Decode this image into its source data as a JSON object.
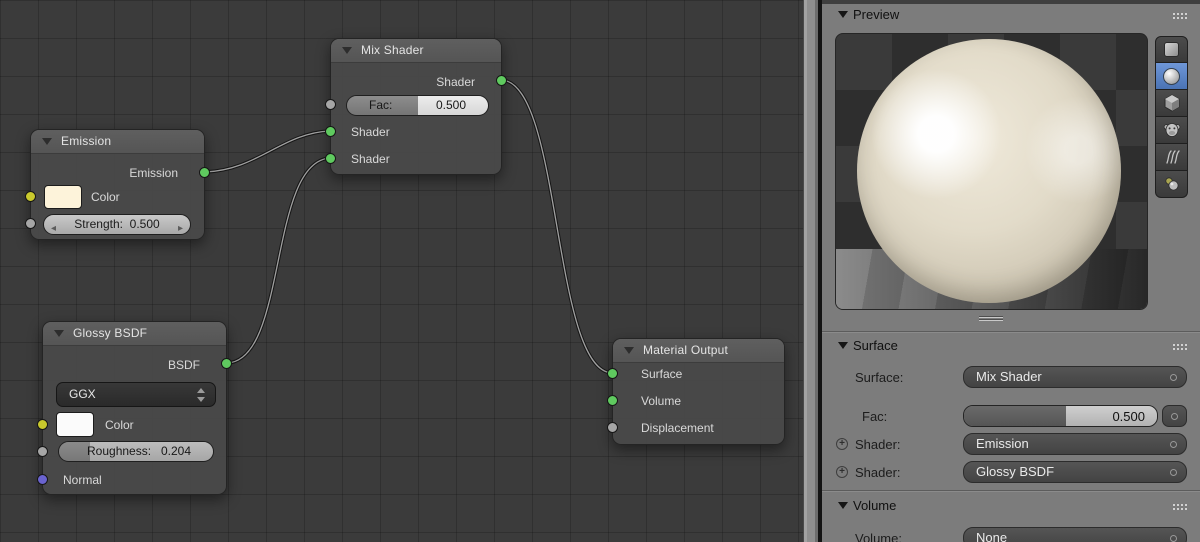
{
  "editor": {
    "nodes": {
      "mix_shader": {
        "title": "Mix Shader",
        "output_label": "Shader",
        "fac_label": "Fac:",
        "fac_value": "0.500",
        "input1_label": "Shader",
        "input2_label": "Shader"
      },
      "emission": {
        "title": "Emission",
        "output_label": "Emission",
        "color_label": "Color",
        "strength_label": "Strength:",
        "strength_value": "0.500"
      },
      "glossy": {
        "title": "Glossy BSDF",
        "output_label": "BSDF",
        "distribution": "GGX",
        "color_label": "Color",
        "roughness_label": "Roughness:",
        "roughness_value": "0.204",
        "normal_label": "Normal"
      },
      "material_output": {
        "title": "Material Output",
        "input1_label": "Surface",
        "input2_label": "Volume",
        "input3_label": "Displacement"
      }
    }
  },
  "panel": {
    "preview": {
      "title": "Preview",
      "modes": [
        "flat",
        "sphere",
        "cube",
        "monkey",
        "hair",
        "spheres"
      ],
      "active_mode": "sphere"
    },
    "surface": {
      "title": "Surface",
      "surface_label": "Surface:",
      "surface_value": "Mix Shader",
      "fac_label": "Fac:",
      "fac_value": "0.500",
      "shader1_label": "Shader:",
      "shader1_value": "Emission",
      "shader2_label": "Shader:",
      "shader2_value": "Glossy BSDF"
    },
    "volume": {
      "title": "Volume",
      "volume_label": "Volume:",
      "volume_value": "None"
    }
  },
  "colors": {
    "socket_shader": "#5fca5f",
    "socket_color": "#c9c92d",
    "socket_value": "#a6a6a6",
    "socket_vector": "#6a63cf",
    "active_mode_blue": "#5680c2",
    "emission_color_swatch": "#fdf3da",
    "glossy_color_swatch": "#fbfbfb"
  }
}
